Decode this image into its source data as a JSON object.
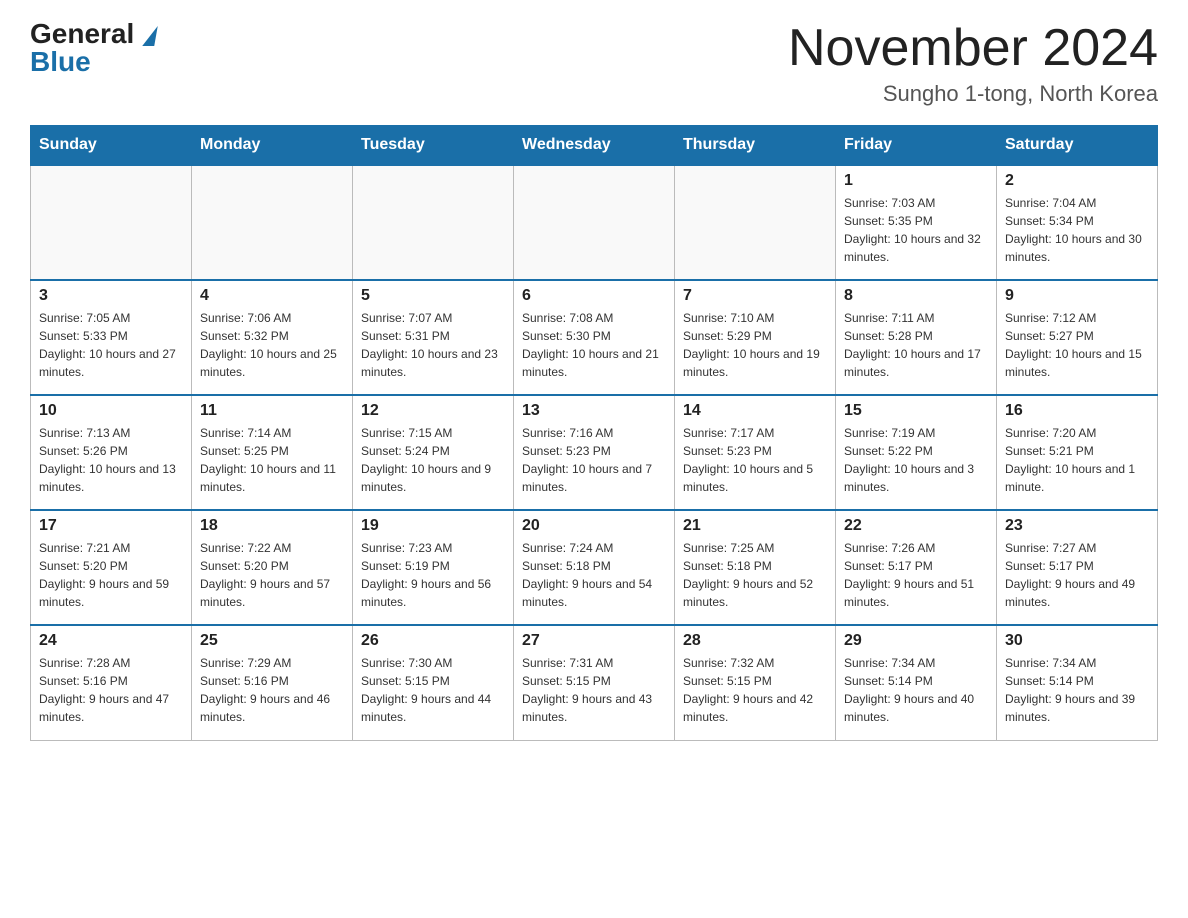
{
  "header": {
    "logo_general": "General",
    "logo_blue": "Blue",
    "month_title": "November 2024",
    "location": "Sungho 1-tong, North Korea"
  },
  "days_of_week": [
    "Sunday",
    "Monday",
    "Tuesday",
    "Wednesday",
    "Thursday",
    "Friday",
    "Saturday"
  ],
  "weeks": [
    [
      {
        "day": "",
        "info": ""
      },
      {
        "day": "",
        "info": ""
      },
      {
        "day": "",
        "info": ""
      },
      {
        "day": "",
        "info": ""
      },
      {
        "day": "",
        "info": ""
      },
      {
        "day": "1",
        "info": "Sunrise: 7:03 AM\nSunset: 5:35 PM\nDaylight: 10 hours and 32 minutes."
      },
      {
        "day": "2",
        "info": "Sunrise: 7:04 AM\nSunset: 5:34 PM\nDaylight: 10 hours and 30 minutes."
      }
    ],
    [
      {
        "day": "3",
        "info": "Sunrise: 7:05 AM\nSunset: 5:33 PM\nDaylight: 10 hours and 27 minutes."
      },
      {
        "day": "4",
        "info": "Sunrise: 7:06 AM\nSunset: 5:32 PM\nDaylight: 10 hours and 25 minutes."
      },
      {
        "day": "5",
        "info": "Sunrise: 7:07 AM\nSunset: 5:31 PM\nDaylight: 10 hours and 23 minutes."
      },
      {
        "day": "6",
        "info": "Sunrise: 7:08 AM\nSunset: 5:30 PM\nDaylight: 10 hours and 21 minutes."
      },
      {
        "day": "7",
        "info": "Sunrise: 7:10 AM\nSunset: 5:29 PM\nDaylight: 10 hours and 19 minutes."
      },
      {
        "day": "8",
        "info": "Sunrise: 7:11 AM\nSunset: 5:28 PM\nDaylight: 10 hours and 17 minutes."
      },
      {
        "day": "9",
        "info": "Sunrise: 7:12 AM\nSunset: 5:27 PM\nDaylight: 10 hours and 15 minutes."
      }
    ],
    [
      {
        "day": "10",
        "info": "Sunrise: 7:13 AM\nSunset: 5:26 PM\nDaylight: 10 hours and 13 minutes."
      },
      {
        "day": "11",
        "info": "Sunrise: 7:14 AM\nSunset: 5:25 PM\nDaylight: 10 hours and 11 minutes."
      },
      {
        "day": "12",
        "info": "Sunrise: 7:15 AM\nSunset: 5:24 PM\nDaylight: 10 hours and 9 minutes."
      },
      {
        "day": "13",
        "info": "Sunrise: 7:16 AM\nSunset: 5:23 PM\nDaylight: 10 hours and 7 minutes."
      },
      {
        "day": "14",
        "info": "Sunrise: 7:17 AM\nSunset: 5:23 PM\nDaylight: 10 hours and 5 minutes."
      },
      {
        "day": "15",
        "info": "Sunrise: 7:19 AM\nSunset: 5:22 PM\nDaylight: 10 hours and 3 minutes."
      },
      {
        "day": "16",
        "info": "Sunrise: 7:20 AM\nSunset: 5:21 PM\nDaylight: 10 hours and 1 minute."
      }
    ],
    [
      {
        "day": "17",
        "info": "Sunrise: 7:21 AM\nSunset: 5:20 PM\nDaylight: 9 hours and 59 minutes."
      },
      {
        "day": "18",
        "info": "Sunrise: 7:22 AM\nSunset: 5:20 PM\nDaylight: 9 hours and 57 minutes."
      },
      {
        "day": "19",
        "info": "Sunrise: 7:23 AM\nSunset: 5:19 PM\nDaylight: 9 hours and 56 minutes."
      },
      {
        "day": "20",
        "info": "Sunrise: 7:24 AM\nSunset: 5:18 PM\nDaylight: 9 hours and 54 minutes."
      },
      {
        "day": "21",
        "info": "Sunrise: 7:25 AM\nSunset: 5:18 PM\nDaylight: 9 hours and 52 minutes."
      },
      {
        "day": "22",
        "info": "Sunrise: 7:26 AM\nSunset: 5:17 PM\nDaylight: 9 hours and 51 minutes."
      },
      {
        "day": "23",
        "info": "Sunrise: 7:27 AM\nSunset: 5:17 PM\nDaylight: 9 hours and 49 minutes."
      }
    ],
    [
      {
        "day": "24",
        "info": "Sunrise: 7:28 AM\nSunset: 5:16 PM\nDaylight: 9 hours and 47 minutes."
      },
      {
        "day": "25",
        "info": "Sunrise: 7:29 AM\nSunset: 5:16 PM\nDaylight: 9 hours and 46 minutes."
      },
      {
        "day": "26",
        "info": "Sunrise: 7:30 AM\nSunset: 5:15 PM\nDaylight: 9 hours and 44 minutes."
      },
      {
        "day": "27",
        "info": "Sunrise: 7:31 AM\nSunset: 5:15 PM\nDaylight: 9 hours and 43 minutes."
      },
      {
        "day": "28",
        "info": "Sunrise: 7:32 AM\nSunset: 5:15 PM\nDaylight: 9 hours and 42 minutes."
      },
      {
        "day": "29",
        "info": "Sunrise: 7:34 AM\nSunset: 5:14 PM\nDaylight: 9 hours and 40 minutes."
      },
      {
        "day": "30",
        "info": "Sunrise: 7:34 AM\nSunset: 5:14 PM\nDaylight: 9 hours and 39 minutes."
      }
    ]
  ]
}
